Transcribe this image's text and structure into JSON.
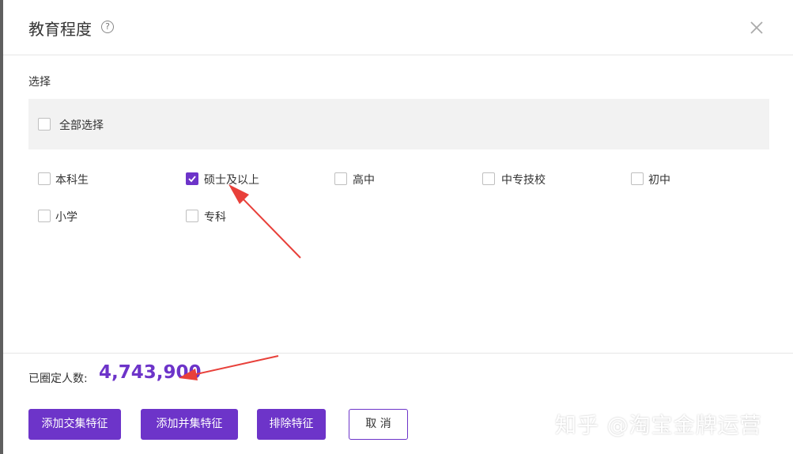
{
  "dialog": {
    "title": "教育程度",
    "help_glyph": "?",
    "close_glyph": "×"
  },
  "section": {
    "label": "选择",
    "select_all": {
      "label": "全部选择",
      "checked": false
    }
  },
  "options": [
    {
      "label": "本科生",
      "checked": false
    },
    {
      "label": "硕士及以上",
      "checked": true
    },
    {
      "label": "高中",
      "checked": false
    },
    {
      "label": "中专技校",
      "checked": false
    },
    {
      "label": "初中",
      "checked": false
    },
    {
      "label": "小学",
      "checked": false
    },
    {
      "label": "专科",
      "checked": false
    }
  ],
  "footer": {
    "count_label": "已圈定人数:",
    "count_value": "4,743,900",
    "buttons": {
      "intersect": "添加交集特征",
      "union": "添加并集特征",
      "exclude": "排除特征",
      "cancel": "取 消"
    }
  },
  "watermark": "知乎 @淘宝金牌运营",
  "colors": {
    "accent": "#6d34c9",
    "annotation_arrow": "#e8403a",
    "select_all_bg": "#f2f2f2"
  }
}
